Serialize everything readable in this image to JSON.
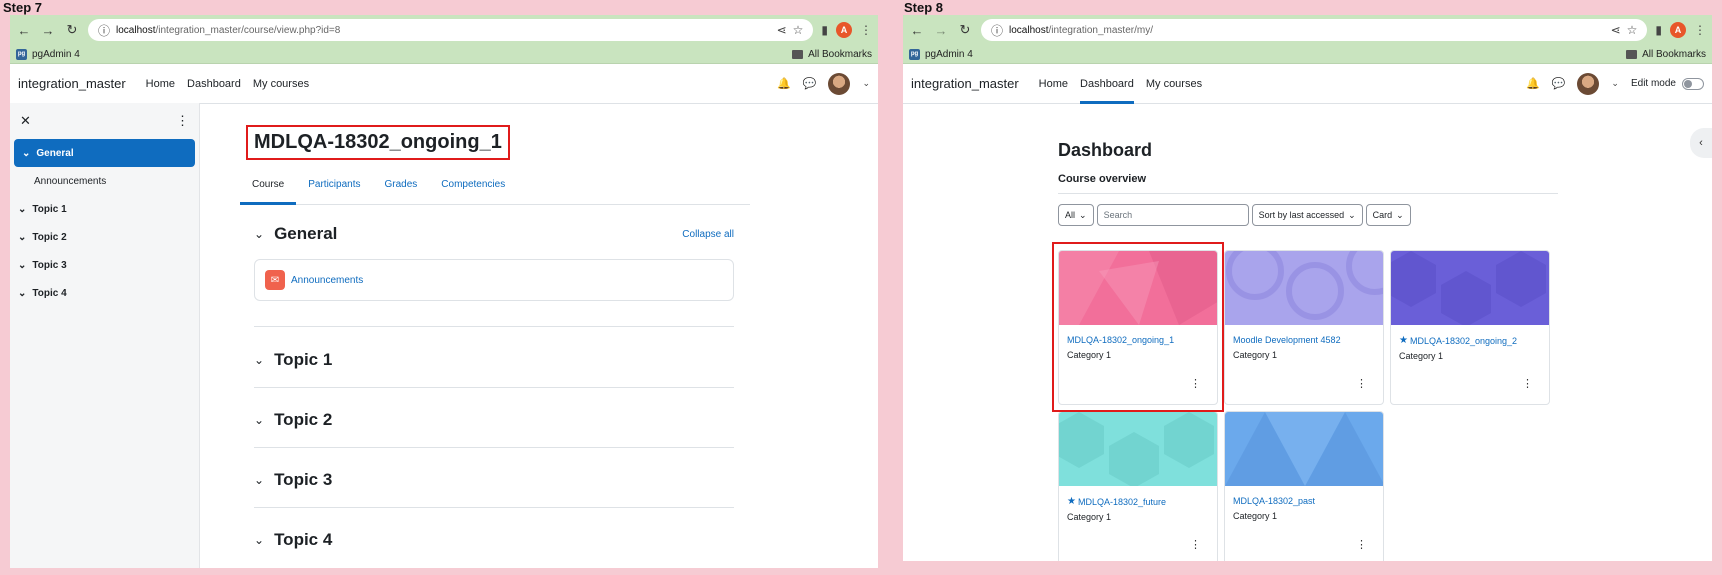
{
  "step7": {
    "label": "Step 7",
    "browser": {
      "url_host": "localhost",
      "url_path": "/integration_master/course/view.php?id=8",
      "bookmark": "pgAdmin 4",
      "all_bookmarks": "All Bookmarks",
      "profile_initial": "A"
    },
    "nav": {
      "site": "integration_master",
      "home": "Home",
      "dashboard": "Dashboard",
      "mycourses": "My courses"
    },
    "drawer": {
      "items": [
        {
          "label": "General",
          "active": true
        },
        {
          "label": "Announcements"
        },
        {
          "label": "Topic 1"
        },
        {
          "label": "Topic 2"
        },
        {
          "label": "Topic 3"
        },
        {
          "label": "Topic 4"
        }
      ]
    },
    "course": {
      "title": "MDLQA-18302_ongoing_1",
      "tabs": [
        "Course",
        "Participants",
        "Grades",
        "Competencies"
      ],
      "collapse_all": "Collapse all",
      "sections": [
        "General",
        "Topic 1",
        "Topic 2",
        "Topic 3",
        "Topic 4"
      ],
      "activity": "Announcements"
    }
  },
  "step8": {
    "label": "Step 8",
    "browser": {
      "url_host": "localhost",
      "url_path": "/integration_master/my/",
      "bookmark": "pgAdmin 4",
      "all_bookmarks": "All Bookmarks",
      "profile_initial": "A"
    },
    "nav": {
      "site": "integration_master",
      "home": "Home",
      "dashboard": "Dashboard",
      "mycourses": "My courses",
      "edit_mode": "Edit mode"
    },
    "dashboard": {
      "title": "Dashboard",
      "subtitle": "Course overview",
      "filter_all": "All",
      "search_placeholder": "Search",
      "sort": "Sort by last accessed",
      "view": "Card",
      "cards": [
        {
          "name": "MDLQA-18302_ongoing_1",
          "category": "Category 1",
          "color": "#f26f9a",
          "starred": false
        },
        {
          "name": "Moodle Development 4582",
          "category": "Category 1",
          "color": "#a9a4ec",
          "starred": false
        },
        {
          "name": "MDLQA-18302_ongoing_2",
          "category": "Category 1",
          "color": "#6a5fd8",
          "starred": true
        },
        {
          "name": "MDLQA-18302_future",
          "category": "Category 1",
          "color": "#7fe0dc",
          "starred": true
        },
        {
          "name": "MDLQA-18302_past",
          "category": "Category 1",
          "color": "#6ba9ec",
          "starred": false
        }
      ]
    }
  }
}
